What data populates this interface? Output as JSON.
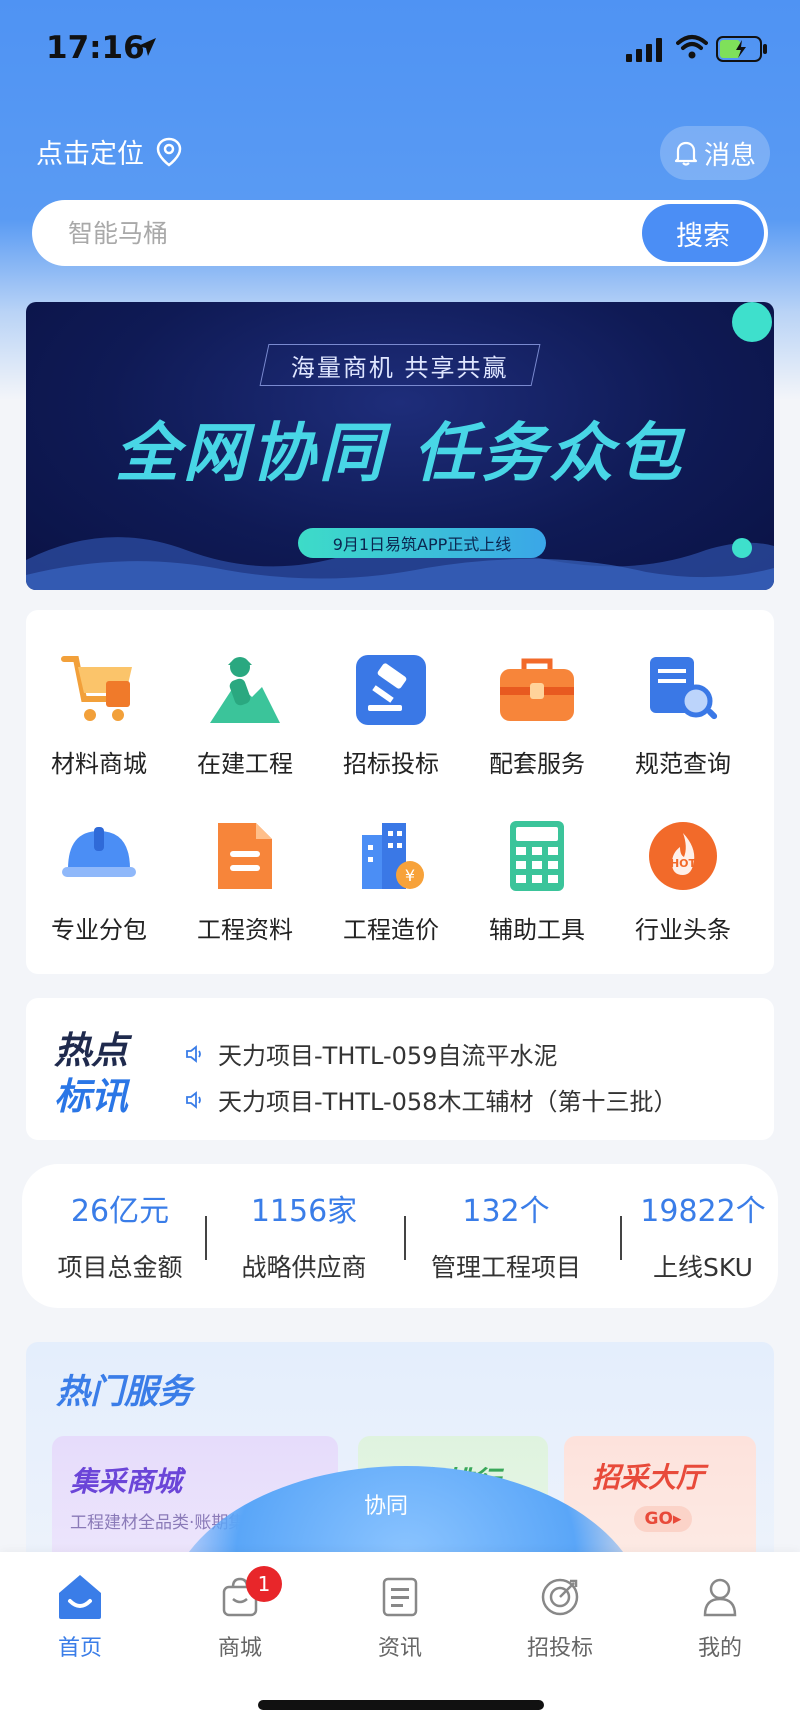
{
  "status_bar": {
    "time": "17:16"
  },
  "header": {
    "location_label": "点击定位",
    "message_label": "消息",
    "search_placeholder": "智能马桶",
    "search_button": "搜索"
  },
  "banner": {
    "slogan": "海量商机  共享共赢",
    "title": "全网协同 任务众包",
    "pill": "9月1日易筑APP正式上线"
  },
  "grid": {
    "items": [
      {
        "label": "材料商城",
        "icon": "cart-icon"
      },
      {
        "label": "在建工程",
        "icon": "worker-icon"
      },
      {
        "label": "招标投标",
        "icon": "gavel-icon"
      },
      {
        "label": "配套服务",
        "icon": "toolbox-icon"
      },
      {
        "label": "规范查询",
        "icon": "doc-search-icon"
      },
      {
        "label": "专业分包",
        "icon": "helmet-icon"
      },
      {
        "label": "工程资料",
        "icon": "file-icon"
      },
      {
        "label": "工程造价",
        "icon": "building-price-icon"
      },
      {
        "label": "辅助工具",
        "icon": "calculator-icon"
      },
      {
        "label": "行业头条",
        "icon": "hot-icon"
      }
    ]
  },
  "news": {
    "logo_line1": "热点",
    "logo_line2": "标讯",
    "items": [
      "天力项目-THTL-059自流平水泥",
      "天力项目-THTL-058木工辅材（第十三批）"
    ]
  },
  "stats": [
    {
      "value": "26亿元",
      "label": "项目总金额"
    },
    {
      "value": "1156家",
      "label": "战略供应商"
    },
    {
      "value": "132个",
      "label": "管理工程项目"
    },
    {
      "value": "19822个",
      "label": "上线SKU"
    }
  ],
  "hot_services": {
    "title": "热门服务",
    "cards": [
      {
        "title": "集采商城",
        "subtitle": "工程建材全品类·账期集采更优"
      },
      {
        "title": "服务排行"
      },
      {
        "title": "招采大厅",
        "cta": "GO"
      }
    ],
    "overlay_label": "协同"
  },
  "tabbar": {
    "tabs": [
      {
        "label": "首页",
        "icon": "home-icon"
      },
      {
        "label": "商城",
        "icon": "shop-bag-icon",
        "badge": "1"
      },
      {
        "label": "资讯",
        "icon": "news-icon"
      },
      {
        "label": "招投标",
        "icon": "target-icon"
      },
      {
        "label": "我的",
        "icon": "profile-icon"
      }
    ]
  },
  "colors": {
    "primary": "#3a7de8",
    "header_bg": "#4f93f3",
    "banner_bg": "#0f1a55",
    "accent_teal": "#48d6e6",
    "badge_red": "#e8262a"
  }
}
